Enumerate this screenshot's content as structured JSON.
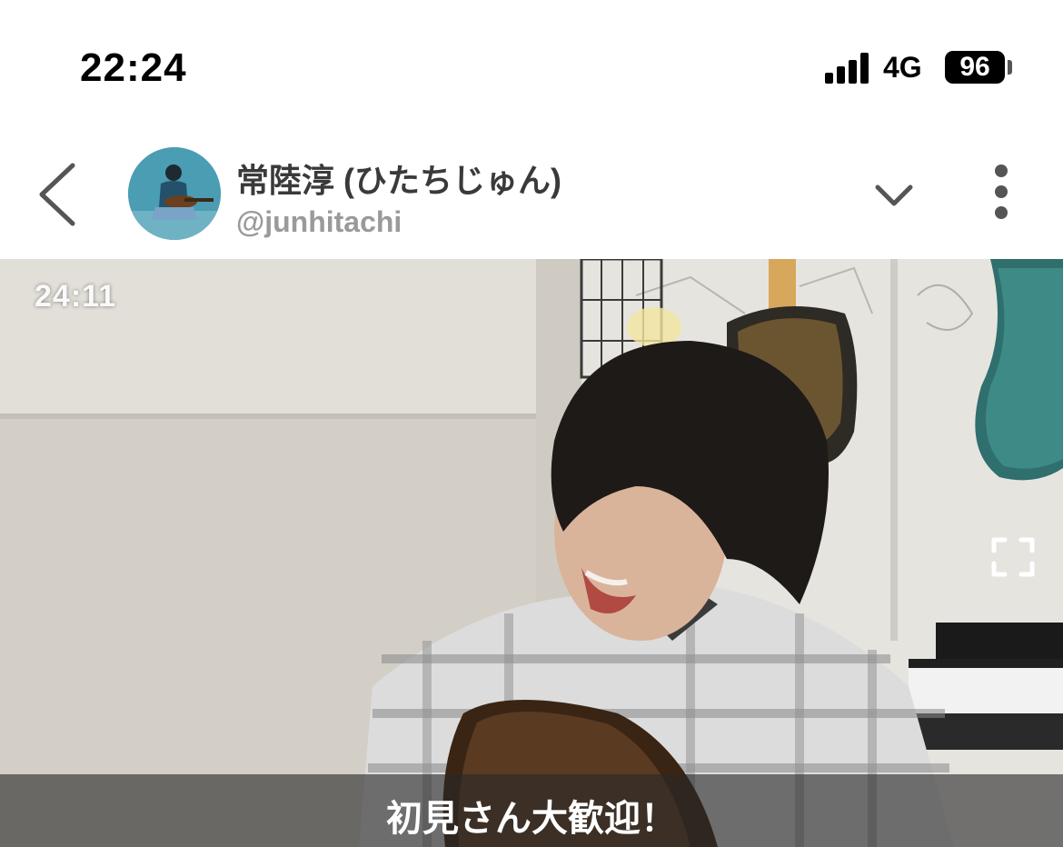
{
  "status_bar": {
    "time": "22:24",
    "network": "4G",
    "battery": "96"
  },
  "header": {
    "channel_name": "常陸淳 (ひたちじゅん)",
    "channel_handle": "@junhitachi",
    "icons": [
      "back-chevron-icon",
      "chevron-down-icon",
      "more-vertical-icon"
    ]
  },
  "video": {
    "timestamp": "24:11",
    "caption": "初見さん大歓迎！",
    "icons": [
      "fullscreen-icon"
    ]
  }
}
